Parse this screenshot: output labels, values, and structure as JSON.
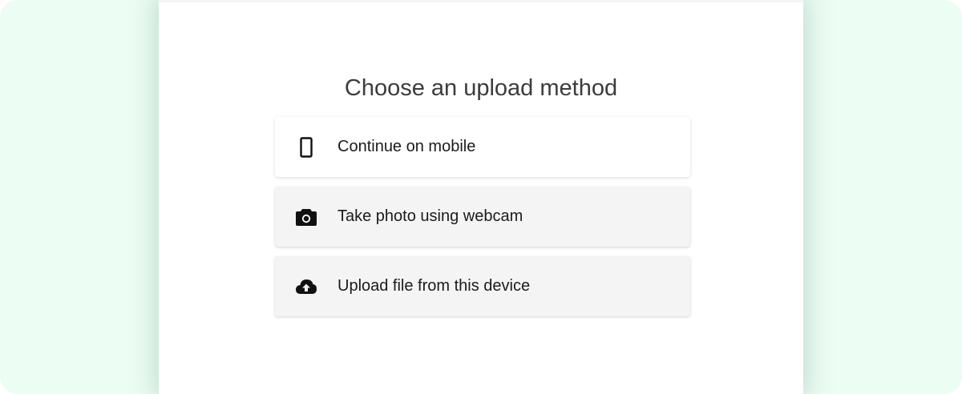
{
  "page": {
    "title": "Choose an upload method"
  },
  "options": [
    {
      "label": "Continue on mobile",
      "icon": "mobile-phone-icon"
    },
    {
      "label": "Take photo using webcam",
      "icon": "camera-icon"
    },
    {
      "label": "Upload file from this device",
      "icon": "cloud-upload-icon"
    }
  ],
  "colors": {
    "backdrop": "#ecfdf4",
    "panel": "#ffffff",
    "option_default": "#ffffff",
    "option_muted": "#f4f4f4",
    "text": "#1b1b1b",
    "title": "#3c3c3c"
  }
}
